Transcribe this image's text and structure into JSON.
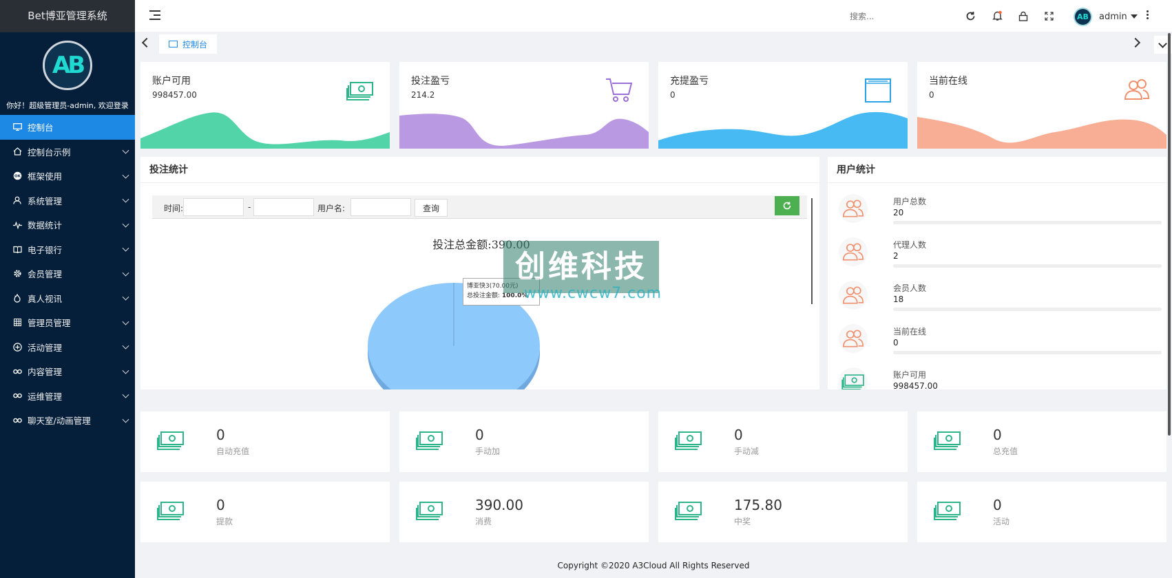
{
  "brand": "Bet博亚管理系统",
  "logo_text": "AB",
  "welcome": "你好！超级管理员-admin, 欢迎登录",
  "sidebar": {
    "items": [
      {
        "label": "控制台",
        "icon": "monitor-icon",
        "active": true
      },
      {
        "label": "控制台示例",
        "icon": "home-icon"
      },
      {
        "label": "框架使用",
        "icon": "ok-icon"
      },
      {
        "label": "系统管理",
        "icon": "user-icon"
      },
      {
        "label": "数据统计",
        "icon": "pulse-icon"
      },
      {
        "label": "电子银行",
        "icon": "book-icon"
      },
      {
        "label": "会员管理",
        "icon": "gear-icon"
      },
      {
        "label": "真人视讯",
        "icon": "fire-icon"
      },
      {
        "label": "管理员管理",
        "icon": "grid-icon"
      },
      {
        "label": "活动管理",
        "icon": "plus-circle-icon"
      },
      {
        "label": "内容管理",
        "icon": "link-icon"
      },
      {
        "label": "运维管理",
        "icon": "link-icon"
      },
      {
        "label": "聊天室/动画管理",
        "icon": "link-icon"
      }
    ]
  },
  "topbar": {
    "search_placeholder": "搜索...",
    "username": "admin",
    "user_avatar_text": "AB"
  },
  "tabs": [
    {
      "label": "控制台",
      "icon": "monitor-icon"
    }
  ],
  "stats": [
    {
      "title": "账户可用",
      "value": "998457.00",
      "icon": "money-icon",
      "color": "#3fcf9f"
    },
    {
      "title": "投注盈亏",
      "value": "214.2",
      "icon": "cart-icon",
      "color": "#b38ee0"
    },
    {
      "title": "充提盈亏",
      "value": "0",
      "icon": "window-icon",
      "color": "#3db6f2"
    },
    {
      "title": "当前在线",
      "value": "0",
      "icon": "users-icon",
      "color": "#f7a58a"
    }
  ],
  "bet_stats": {
    "title": "投注统计",
    "filter": {
      "time_label": "时间:",
      "separator": "-",
      "username_label": "用户名:",
      "query_button": "查询"
    },
    "total_label": "投注总金额:390.00",
    "tooltip_line1": "博亚快3(70.00元)",
    "tooltip_line2_label": "总投注金额: ",
    "tooltip_line2_value": "100.0%"
  },
  "chart_data": {
    "type": "pie",
    "title": "投注总金额:390.00",
    "categories": [
      "博亚快3"
    ],
    "values": [
      70.0
    ],
    "percent": [
      100.0
    ]
  },
  "watermark": {
    "main": "创维科技",
    "sub": "www.cwcw7.com"
  },
  "user_stats": {
    "title": "用户统计",
    "rows": [
      {
        "label": "用户总数",
        "value": "20",
        "icon": "users-icon"
      },
      {
        "label": "代理人数",
        "value": "2",
        "icon": "users-icon"
      },
      {
        "label": "会员人数",
        "value": "18",
        "icon": "users-icon"
      },
      {
        "label": "当前在线",
        "value": "0",
        "icon": "users-icon"
      },
      {
        "label": "账户可用",
        "value": "998457.00",
        "icon": "money-icon"
      }
    ]
  },
  "money_cards": [
    {
      "value": "0",
      "label": "自动充值"
    },
    {
      "value": "0",
      "label": "手动加"
    },
    {
      "value": "0",
      "label": "手动减"
    },
    {
      "value": "0",
      "label": "总充值"
    },
    {
      "value": "0",
      "label": "提款"
    },
    {
      "value": "390.00",
      "label": "消费"
    },
    {
      "value": "175.80",
      "label": "中奖"
    },
    {
      "value": "0",
      "label": "活动"
    }
  ],
  "footer": "Copyright ©2020 A3Cloud All Rights Reserved"
}
